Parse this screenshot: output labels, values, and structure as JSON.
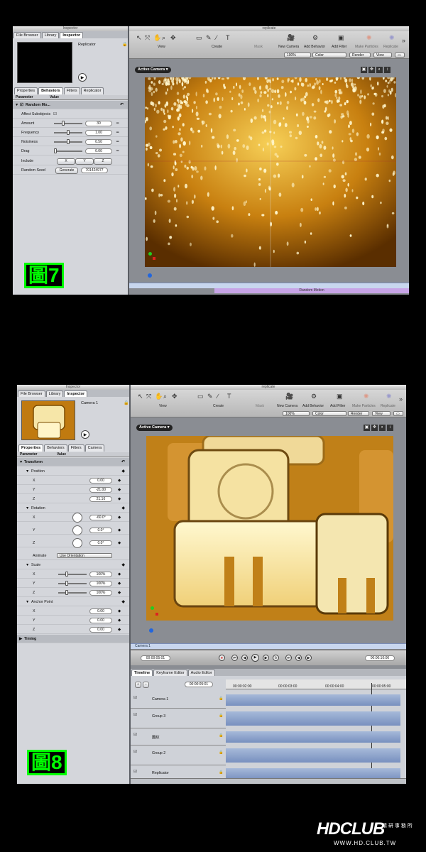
{
  "shot1": {
    "inspector_title": "Inspector",
    "window_title": "replicate",
    "tabs": [
      "File Browser",
      "Library",
      "Inspector"
    ],
    "preview_name": "Replicator",
    "subtabs": [
      "Properties",
      "Behaviors",
      "Filters",
      "Replicator"
    ],
    "col_param": "Parameter",
    "col_value": "Value",
    "behavior": "Random Mo...",
    "affect_subobjects": "Affect Subobjects",
    "params": [
      {
        "label": "Amount",
        "value": "30",
        "slider": 0.3
      },
      {
        "label": "Frequency",
        "value": "1.00",
        "slider": 0.5
      },
      {
        "label": "Noisiness",
        "value": "0.50",
        "slider": 0.5
      },
      {
        "label": "Drag",
        "value": "0.00",
        "slider": 0.0
      }
    ],
    "include_label": "Include",
    "include_opts": [
      "X",
      "Y",
      "Z"
    ],
    "seed_label": "Random Seed",
    "generate": "Generate",
    "seed_value": "701424977",
    "toolbar_groups": [
      "View",
      "Create",
      "Mask",
      "New Camera",
      "Add Behavior",
      "Add Filter",
      "Make Particles",
      "Replicate"
    ],
    "zoom": "100%",
    "color": "Color",
    "render": "Render",
    "view": "View",
    "active_camera": "Active Camera",
    "bottom_label": "Random Motion",
    "badge": "圖7"
  },
  "shot2": {
    "inspector_title": "Inspector",
    "window_title": "replicate",
    "tabs": [
      "File Browser",
      "Library",
      "Inspector"
    ],
    "preview_name": "Camera 1",
    "subtabs": [
      "Properties",
      "Behaviors",
      "Filters",
      "Camera"
    ],
    "col_param": "Parameter",
    "col_value": "Value",
    "transform": "Transform",
    "position": "Position",
    "pos": [
      {
        "label": "X",
        "value": "0.00"
      },
      {
        "label": "Y",
        "value": "-21.00"
      },
      {
        "label": "Z",
        "value": "21.10"
      }
    ],
    "rotation": "Rotation",
    "rot": [
      {
        "label": "X",
        "value": "-60.0°"
      },
      {
        "label": "Y",
        "value": "0.0°"
      },
      {
        "label": "Z",
        "value": "0.0°"
      }
    ],
    "animate_label": "Animate",
    "animate_value": "Use Orientation",
    "scale": "Scale",
    "scl": [
      {
        "label": "X",
        "value": "100%"
      },
      {
        "label": "Y",
        "value": "100%"
      },
      {
        "label": "Z",
        "value": "100%"
      }
    ],
    "anchor": "Anchor Point",
    "anc": [
      {
        "label": "X",
        "value": "0.00"
      },
      {
        "label": "Y",
        "value": "0.00"
      },
      {
        "label": "Z",
        "value": "0.00"
      }
    ],
    "timing": "Timing",
    "toolbar_groups": [
      "View",
      "Create",
      "Mask",
      "New Camera",
      "Add Behavior",
      "Add Filter",
      "Make Particles",
      "Replicate"
    ],
    "zoom": "100%",
    "color": "Color",
    "render": "Render",
    "view": "View",
    "active_camera": "Active Camera",
    "camera_bar": "Camera 1",
    "current_time": "00:00:05:01",
    "duration": "00:00:10:00",
    "timeline_tabs": [
      "Timeline",
      "Keyframe Editor",
      "Audio Editor"
    ],
    "tl_time": "00:00:05:01",
    "ruler": [
      "00:00:02:00",
      "00:00:03:00",
      "00:00:04:00",
      "00:00:05:00"
    ],
    "layers": [
      "Camera 1",
      "Group 3",
      "圖紋",
      "Group 2",
      "Replicator"
    ],
    "badge": "圖8"
  },
  "watermark": {
    "logo": "HDCLUB",
    "cn": "精 研 事 務 所",
    "url": "WWW.HD.CLUB.TW"
  }
}
